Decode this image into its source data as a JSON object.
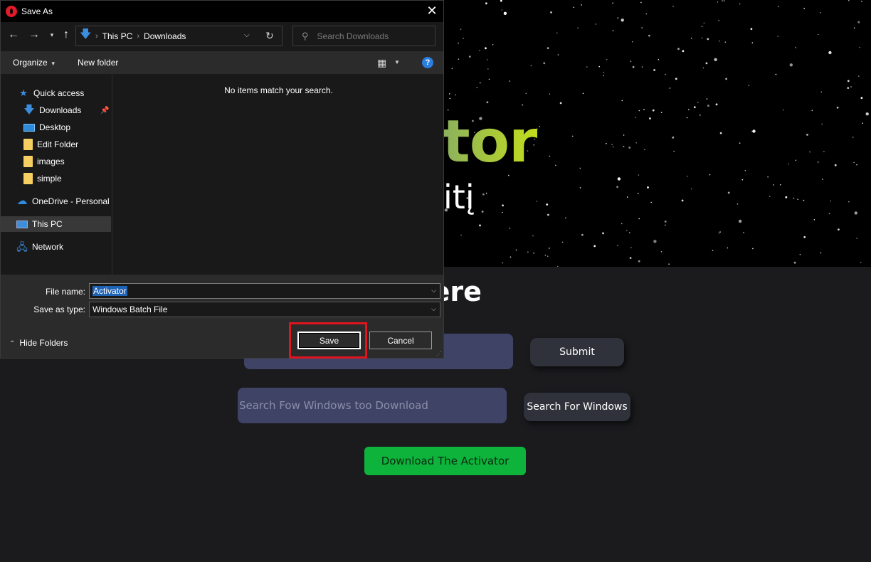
{
  "page": {
    "hero_title": "s Activator",
    "hero_subtitle": "d By ArDitį",
    "version_heading": "ws Version Here",
    "version_input_placeholder": "",
    "submit_label": "Submit",
    "search_placeholder": "Search Fow Windows too Download",
    "search_button_label": "Search For Windows",
    "download_button_label": "Download The Activator",
    "download_color": "#0db33a",
    "hero_gradient": [
      "#3f78a8",
      "#c3dd1c"
    ]
  },
  "dialog": {
    "app_icon": "opera-icon",
    "title": "Save As",
    "close_glyph": "✕",
    "address": {
      "crumbs": [
        "This PC",
        "Downloads"
      ],
      "search_placeholder": "Search Downloads"
    },
    "toolbar": {
      "organize_label": "Organize",
      "new_folder_label": "New folder",
      "help_glyph": "?"
    },
    "nav": {
      "items": [
        {
          "label": "Quick access",
          "icon": "star-icon"
        },
        {
          "label": "Downloads",
          "icon": "download-icon"
        },
        {
          "label": "Desktop",
          "icon": "desktop-icon"
        },
        {
          "label": "Edit Folder",
          "icon": "folder-icon"
        },
        {
          "label": "images",
          "icon": "folder-icon"
        },
        {
          "label": "simple",
          "icon": "folder-icon"
        },
        {
          "label": "OneDrive - Personal",
          "icon": "cloud-icon"
        },
        {
          "label": "This PC",
          "icon": "pc-icon"
        },
        {
          "label": "Network",
          "icon": "network-icon"
        }
      ],
      "selected": "This PC"
    },
    "empty_message": "No items match your search.",
    "file_name_label": "File name:",
    "file_name_value": "Activator",
    "save_type_label": "Save as type:",
    "save_type_value": "Windows Batch File",
    "hide_folders_label": "Hide Folders",
    "save_label": "Save",
    "cancel_label": "Cancel",
    "highlight_color": "#e0141e",
    "accent_color": "#3b8de0"
  }
}
